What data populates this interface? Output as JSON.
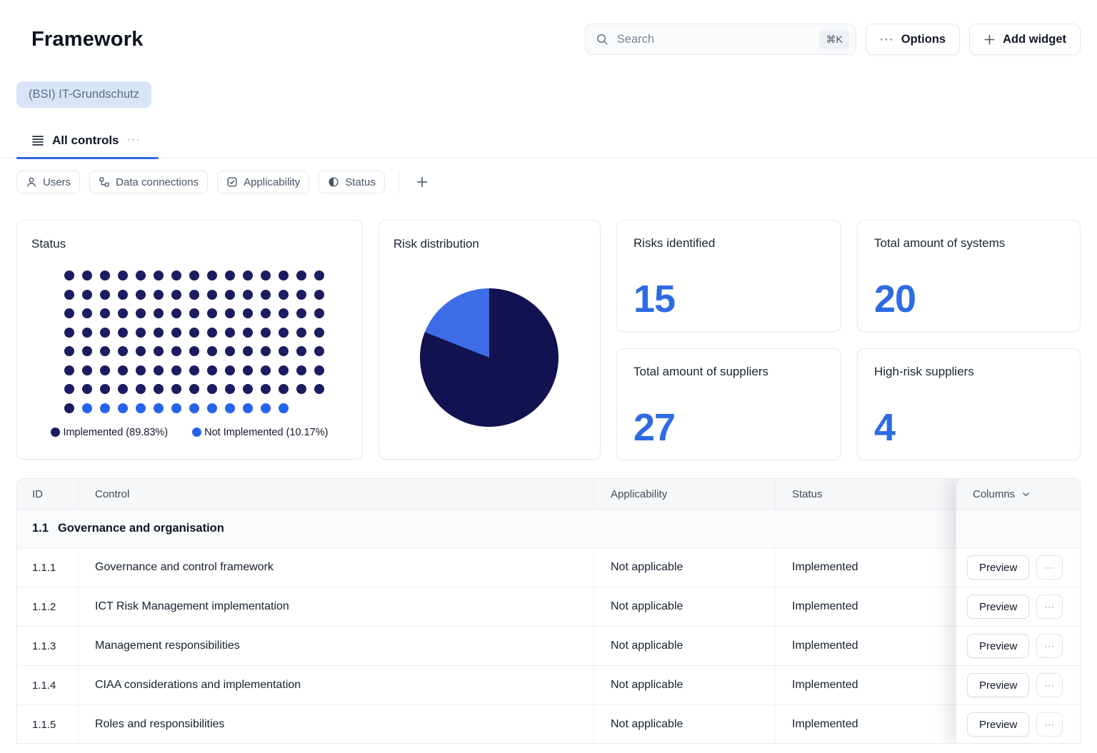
{
  "page": {
    "title": "Framework"
  },
  "topbar": {
    "search": {
      "placeholder": "Search",
      "shortcut": "⌘K"
    },
    "options": {
      "label": "Options"
    },
    "add_widget": {
      "label": "Add widget"
    }
  },
  "framework_chip": {
    "label": "(BSI) IT-Grundschutz"
  },
  "tabs": {
    "all_controls": {
      "label": "All controls"
    }
  },
  "filters": [
    {
      "key": "users",
      "label": "Users",
      "icon": "user-icon"
    },
    {
      "key": "data-connections",
      "label": "Data connections",
      "icon": "hierarchy-icon"
    },
    {
      "key": "applicability",
      "label": "Applicability",
      "icon": "checkbox-icon"
    },
    {
      "key": "status",
      "label": "Status",
      "icon": "contrast-icon"
    }
  ],
  "widgets": {
    "status": {
      "title": "Status"
    },
    "risk_distribution": {
      "title": "Risk distribution"
    },
    "stats": [
      {
        "title": "Risks identified",
        "value": "15"
      },
      {
        "title": "Total amount of systems",
        "value": "20"
      },
      {
        "title": "Total amount of suppliers",
        "value": "27"
      },
      {
        "title": "High-risk suppliers",
        "value": "4"
      }
    ]
  },
  "chart_data": [
    {
      "type": "waffle-dot",
      "title": "Status",
      "dots_per_row": 15,
      "total_dots": 118,
      "series": [
        {
          "name": "Implemented",
          "dots": 106,
          "share_label": "89.83%",
          "color": "#1c1c60"
        },
        {
          "name": "Not Implemented",
          "dots": 12,
          "share_label": "10.17%",
          "color": "#2563eb"
        }
      ],
      "legend_position": "bottom"
    },
    {
      "type": "pie",
      "title": "Risk distribution",
      "series": [
        {
          "name": "dark-slice",
          "value": 81,
          "color": "#131250"
        },
        {
          "name": "blue-slice",
          "value": 19,
          "color": "#3c6ce6"
        }
      ],
      "labels_visible": false,
      "start_angle_deg": 0
    }
  ],
  "table": {
    "headers": {
      "id": "ID",
      "control": "Control",
      "applicability": "Applicability",
      "status": "Status"
    },
    "columns_menu": {
      "label": "Columns"
    },
    "section": {
      "id": "1.1",
      "title": "Governance and organisation"
    },
    "row_action": {
      "preview_label": "Preview",
      "more_label": "⋯"
    },
    "rows": [
      {
        "id": "1.1.1",
        "control": "Governance and control framework",
        "applicability": "Not applicable",
        "status": "Implemented"
      },
      {
        "id": "1.1.2",
        "control": "ICT Risk Management implementation",
        "applicability": "Not applicable",
        "status": "Implemented"
      },
      {
        "id": "1.1.3",
        "control": "Management responsibilities",
        "applicability": "Not applicable",
        "status": "Implemented"
      },
      {
        "id": "1.1.4",
        "control": "CIAA considerations and implementation",
        "applicability": "Not applicable",
        "status": "Implemented"
      },
      {
        "id": "1.1.5",
        "control": "Roles and responsibilities",
        "applicability": "Not applicable",
        "status": "Implemented"
      }
    ]
  },
  "colors": {
    "accent": "#2e6be2",
    "implemented_navy": "#1c1c60",
    "not_implemented_blue": "#2563eb",
    "pie_navy": "#131250",
    "pie_blue": "#3c6ce6",
    "chip_bg": "#d8e4f8"
  }
}
